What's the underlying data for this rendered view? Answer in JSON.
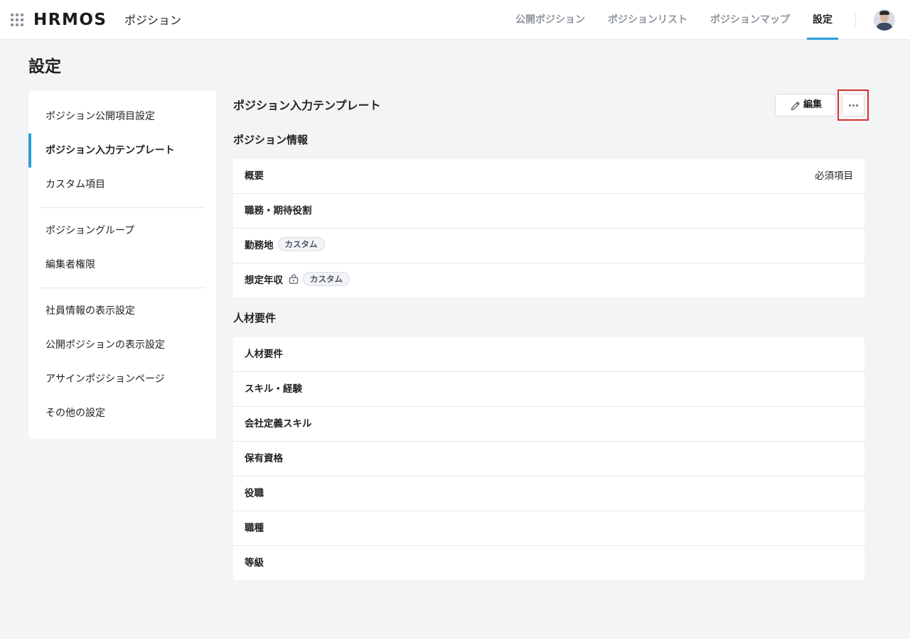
{
  "header": {
    "logo": "HRMOS",
    "app_name": "ポジション",
    "nav": [
      {
        "label": "公開ポジション",
        "active": false
      },
      {
        "label": "ポジションリスト",
        "active": false
      },
      {
        "label": "ポジションマップ",
        "active": false
      },
      {
        "label": "設定",
        "active": true
      }
    ],
    "accent_color": "#2d9cdb"
  },
  "page": {
    "title": "設定"
  },
  "sidebar": {
    "items": [
      {
        "label": "ポジション公開項目設定"
      },
      {
        "label": "ポジション入力テンプレート",
        "active": true
      },
      {
        "label": "カスタム項目"
      },
      {
        "label": "ポジショングループ"
      },
      {
        "label": "編集者権限"
      },
      {
        "label": "社員情報の表示設定"
      },
      {
        "label": "公開ポジションの表示設定"
      },
      {
        "label": "アサインポジションページ"
      },
      {
        "label": "その他の設定"
      }
    ]
  },
  "main": {
    "title": "ポジション入力テンプレート",
    "edit_label": "編集",
    "more_icon": "more-horizontal-icon",
    "highlight_color": "#d9302b",
    "sections": [
      {
        "title": "ポジション情報",
        "rows": [
          {
            "label": "概要",
            "right": "必須項目"
          },
          {
            "label": "職務・期待役割"
          },
          {
            "label": "勤務地",
            "badge": "カスタム"
          },
          {
            "label": "想定年収",
            "lock": true,
            "badge": "カスタム"
          }
        ]
      },
      {
        "title": "人材要件",
        "rows": [
          {
            "label": "人材要件"
          },
          {
            "label": "スキル・経験"
          },
          {
            "label": "会社定義スキル"
          },
          {
            "label": "保有資格"
          },
          {
            "label": "役職"
          },
          {
            "label": "職種"
          },
          {
            "label": "等級"
          }
        ]
      }
    ]
  }
}
